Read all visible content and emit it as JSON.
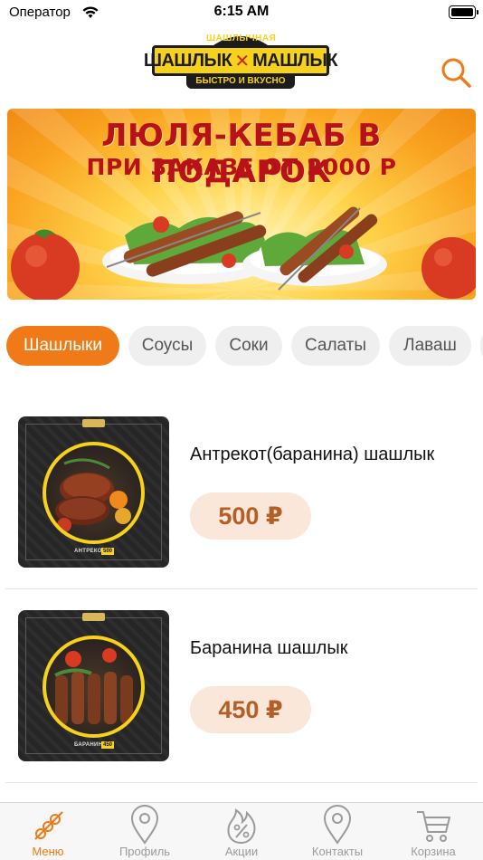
{
  "status_bar": {
    "carrier": "Оператор",
    "time": "6:15 AM"
  },
  "header": {
    "logo": {
      "top": "ШАШЛЫЧНАЯ",
      "word_left": "ШАШЛЫК",
      "word_right": "МАШЛЫК",
      "bottom": "БЫСТРО И ВКУСНО"
    },
    "search_icon": "search-icon"
  },
  "banner": {
    "line1": "ЛЮЛЯ-КЕБАБ В ПОДАРОК",
    "line2": "ПРИ ЗАКАЗЕ ОТ 2000 Р"
  },
  "categories": [
    {
      "label": "Шашлыки",
      "active": true
    },
    {
      "label": "Соусы",
      "active": false
    },
    {
      "label": "Соки",
      "active": false
    },
    {
      "label": "Салаты",
      "active": false
    },
    {
      "label": "Лаваш",
      "active": false
    }
  ],
  "products": [
    {
      "name": "Антрекот(баранина) шашлык",
      "price": "500 ₽",
      "thumb_label": "АНТРЕКОТ",
      "thumb_price": "500"
    },
    {
      "name": "Баранина шашлык",
      "price": "450 ₽",
      "thumb_label": "БАРАНИНА",
      "thumb_price": "450"
    }
  ],
  "tabs": [
    {
      "label": "Меню",
      "icon": "skewer-icon",
      "active": true
    },
    {
      "label": "Профиль",
      "icon": "location-pin-icon",
      "active": false
    },
    {
      "label": "Акции",
      "icon": "fire-percent-icon",
      "active": false
    },
    {
      "label": "Контакты",
      "icon": "location-pin-icon",
      "active": false
    },
    {
      "label": "Корзина",
      "icon": "cart-icon",
      "active": false
    }
  ],
  "colors": {
    "accent": "#f07a17",
    "price_bg": "#fbe7d9",
    "price_text": "#b35f26",
    "chip_bg": "#efefef",
    "banner_text": "#b8111a"
  }
}
